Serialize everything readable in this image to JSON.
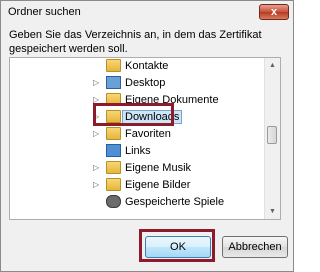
{
  "dialog": {
    "title": "Ordner suchen",
    "close_glyph": "x",
    "description": "Geben Sie das Verzeichnis an, in dem das Zertifikat gespeichert werden soll."
  },
  "tree": {
    "items": [
      {
        "label": "Kontakte",
        "icon": "contacts-folder-icon",
        "expander": ""
      },
      {
        "label": "Desktop",
        "icon": "desktop-folder-icon",
        "expander": "▷"
      },
      {
        "label": "Eigene Dokumente",
        "icon": "documents-folder-icon",
        "expander": "▷"
      },
      {
        "label": "Downloads",
        "icon": "downloads-folder-icon",
        "expander": "▷",
        "selected": true
      },
      {
        "label": "Favoriten",
        "icon": "favorites-folder-icon",
        "expander": "▷"
      },
      {
        "label": "Links",
        "icon": "links-folder-icon",
        "expander": ""
      },
      {
        "label": "Eigene Musik",
        "icon": "music-folder-icon",
        "expander": "▷"
      },
      {
        "label": "Eigene Bilder",
        "icon": "pictures-folder-icon",
        "expander": "▷"
      },
      {
        "label": "Gespeicherte Spiele",
        "icon": "saved-games-folder-icon",
        "expander": ""
      }
    ]
  },
  "buttons": {
    "ok": "OK",
    "cancel": "Abbrechen"
  },
  "colors": {
    "highlight_frame": "#8c1b2b",
    "selection_fill": "#cde6f7",
    "close_button": "#c6503a"
  }
}
